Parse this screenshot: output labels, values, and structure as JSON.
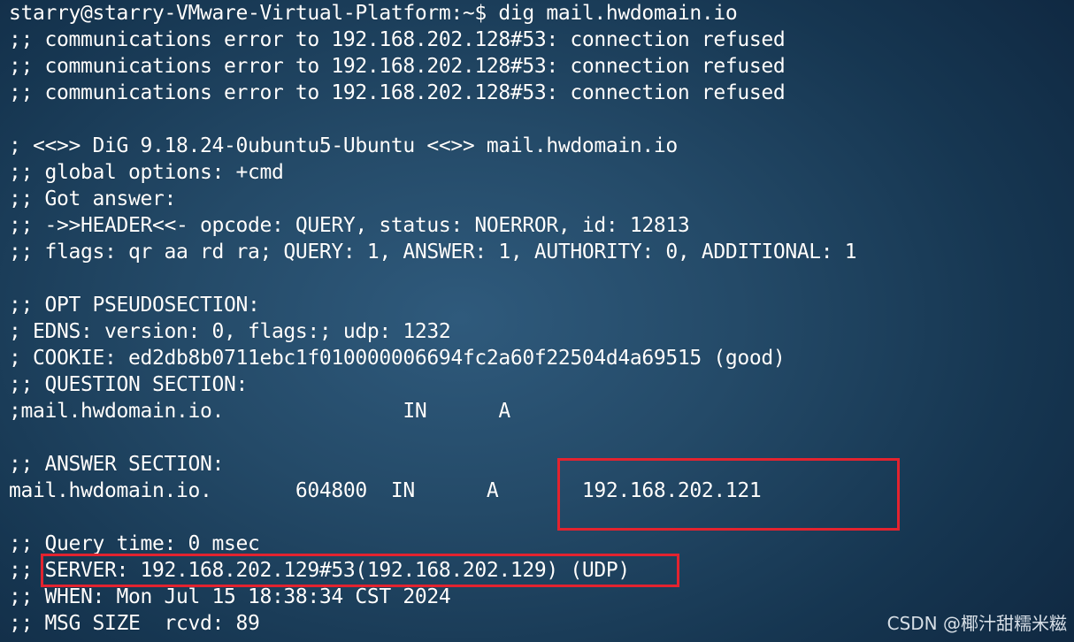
{
  "terminal": {
    "lines": [
      "starry@starry-VMware-Virtual-Platform:~$ dig mail.hwdomain.io",
      ";; communications error to 192.168.202.128#53: connection refused",
      ";; communications error to 192.168.202.128#53: connection refused",
      ";; communications error to 192.168.202.128#53: connection refused",
      "",
      "; <<>> DiG 9.18.24-0ubuntu5-Ubuntu <<>> mail.hwdomain.io",
      ";; global options: +cmd",
      ";; Got answer:",
      ";; ->>HEADER<<- opcode: QUERY, status: NOERROR, id: 12813",
      ";; flags: qr aa rd ra; QUERY: 1, ANSWER: 1, AUTHORITY: 0, ADDITIONAL: 1",
      "",
      ";; OPT PSEUDOSECTION:",
      "; EDNS: version: 0, flags:; udp: 1232",
      "; COOKIE: ed2db8b0711ebc1f010000006694fc2a60f22504d4a69515 (good)",
      ";; QUESTION SECTION:",
      ";mail.hwdomain.io.               IN      A",
      "",
      ";; ANSWER SECTION:",
      "mail.hwdomain.io.       604800  IN      A       192.168.202.121",
      "",
      ";; Query time: 0 msec",
      ";; SERVER: 192.168.202.129#53(192.168.202.129) (UDP)",
      ";; WHEN: Mon Jul 15 18:38:34 CST 2024",
      ";; MSG SIZE  rcvd: 89"
    ]
  },
  "watermark": "CSDN @椰汁甜糯米糍",
  "colors": {
    "text": "#ffffff",
    "highlight_border": "#e3232f",
    "background": "#244a68"
  }
}
